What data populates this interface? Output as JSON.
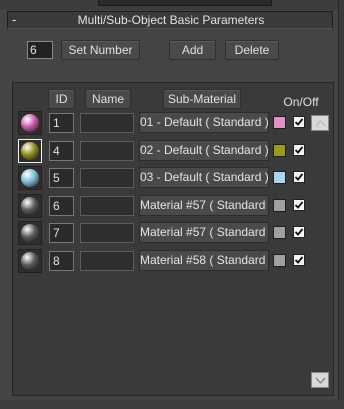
{
  "rollout": {
    "collapse_symbol": "-",
    "title": "Multi/Sub-Object Basic Parameters"
  },
  "controls": {
    "number_value": "6",
    "set_number_label": "Set Number",
    "add_label": "Add",
    "delete_label": "Delete"
  },
  "columns": {
    "id": "ID",
    "name": "Name",
    "sub_material": "Sub-Material",
    "on_off": "On/Off"
  },
  "rows": [
    {
      "id": "1",
      "name": "",
      "sub_material": "01 - Default  ( Standard )",
      "swatch_color": "#e58fc7",
      "ball_color": "#c85aa8",
      "enabled": true,
      "selected": false
    },
    {
      "id": "4",
      "name": "",
      "sub_material": "02 - Default  ( Standard )",
      "swatch_color": "#9a9a1e",
      "ball_color": "#8c8a18",
      "enabled": true,
      "selected": true
    },
    {
      "id": "5",
      "name": "",
      "sub_material": "03 - Default  ( Standard )",
      "swatch_color": "#a8d6ec",
      "ball_color": "#7fb8d4",
      "enabled": true,
      "selected": false
    },
    {
      "id": "6",
      "name": "",
      "sub_material": "Material #57  ( Standard )",
      "swatch_color": "#a0a0a0",
      "ball_color": "#5a5a5a",
      "enabled": true,
      "selected": false
    },
    {
      "id": "7",
      "name": "",
      "sub_material": "Material #57  ( Standard )",
      "swatch_color": "#a0a0a0",
      "ball_color": "#5a5a5a",
      "enabled": true,
      "selected": false
    },
    {
      "id": "8",
      "name": "",
      "sub_material": "Material #58  ( Standard )",
      "swatch_color": "#a0a0a0",
      "ball_color": "#5a5a5a",
      "enabled": true,
      "selected": false
    }
  ],
  "icons": {
    "scroll_up": "chevron-up-icon",
    "scroll_down": "chevron-down-icon",
    "checkbox": "check-icon"
  }
}
